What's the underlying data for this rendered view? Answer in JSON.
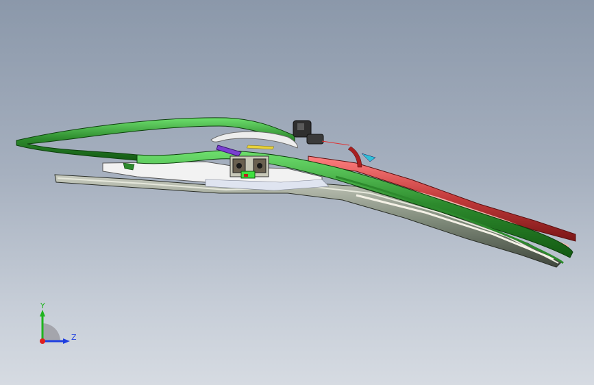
{
  "viewport": {
    "background_top": "#8b98aa",
    "background_bottom": "#d6dbe2"
  },
  "model": {
    "frame_color": "#2d8a2d",
    "frame_highlight": "#5fd05f",
    "spoiler_color": "#c23a3a",
    "blade_color": "#7f8a7a",
    "rubber_color": "#d9dccb",
    "clip_color": "#f2f2f2"
  },
  "triad": {
    "y_label": "Y",
    "z_label": "Z",
    "y_color": "#1fb41f",
    "z_color": "#1f3fe0",
    "x_color": "#e01f1f"
  }
}
